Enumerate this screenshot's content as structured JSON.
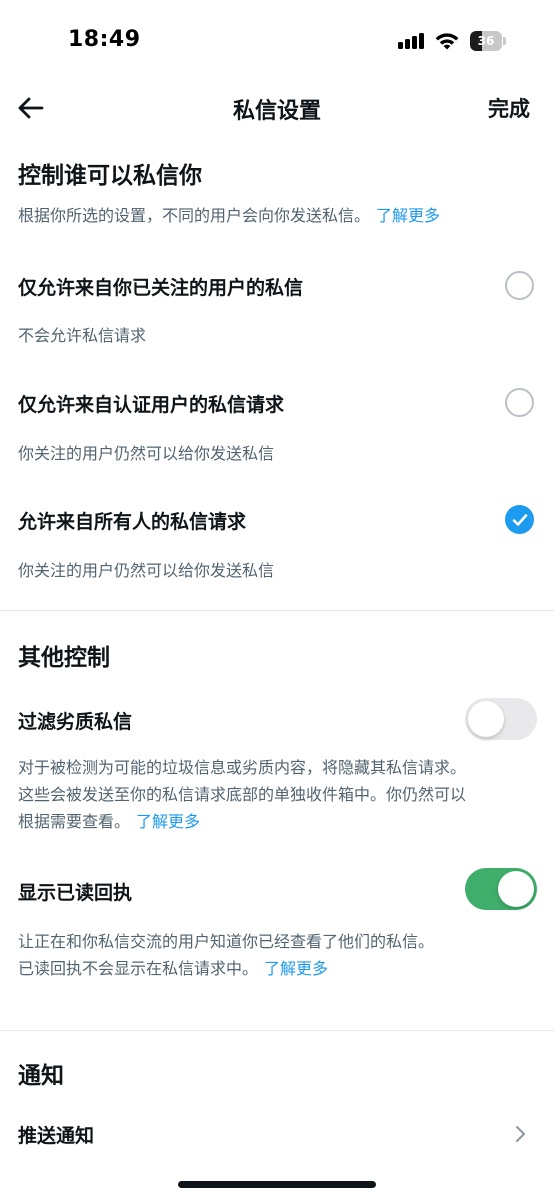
{
  "status_bar": {
    "time": "18:49",
    "battery": "36",
    "battery_level": 0.36,
    "icons": [
      "signal-icon",
      "wifi-icon",
      "battery-icon"
    ]
  },
  "nav": {
    "back_icon": "arrow-left-icon",
    "title": "私信设置",
    "done": "完成"
  },
  "control": {
    "title": "控制谁可以私信你",
    "desc": "根据你所选的设置，不同的用户会向你发送私信。",
    "learn_more": "了解更多",
    "options": [
      {
        "label": "仅允许来自你已关注的用户的私信",
        "sub": "不会允许私信请求",
        "selected": false
      },
      {
        "label": "仅允许来自认证用户的私信请求",
        "sub": "你关注的用户仍然可以给你发送私信",
        "selected": false
      },
      {
        "label": "允许来自所有人的私信请求",
        "sub": "你关注的用户仍然可以给你发送私信",
        "selected": true
      }
    ]
  },
  "other": {
    "title": "其他控制",
    "filter": {
      "label": "过滤劣质私信",
      "on": false,
      "desc_line1": "对于被检测为可能的垃圾信息或劣质内容，将隐藏其私信请求。",
      "desc_line2": "这些会被发送至你的私信请求底部的单独收件箱中。你仍然可以",
      "desc_line3": "根据需要查看。",
      "learn_more": "了解更多"
    },
    "read_receipts": {
      "label": "显示已读回执",
      "on": true,
      "desc_line1": "让正在和你私信交流的用户知道你已经查看了他们的私信。",
      "desc_line2": "已读回执不会显示在私信请求中。",
      "learn_more": "了解更多"
    }
  },
  "notifications": {
    "title": "通知",
    "push": "推送通知"
  },
  "colors": {
    "accent": "#1d9bf0",
    "toggle_on": "#3fae6a",
    "secondary_text": "#536471"
  }
}
